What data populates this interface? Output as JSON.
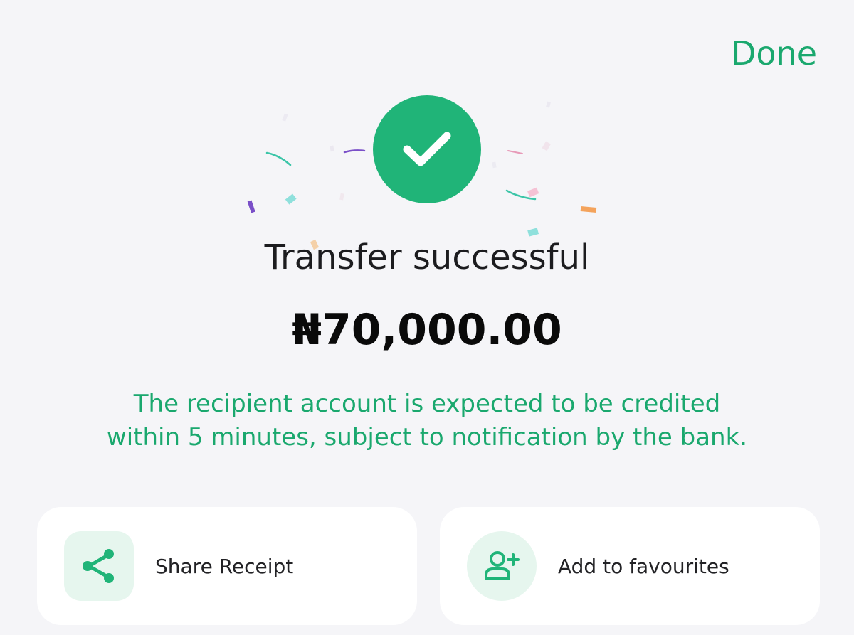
{
  "header": {
    "done_label": "Done"
  },
  "status": {
    "title": "Transfer successful",
    "amount": "₦70,000.00",
    "notice": "The recipient account is expected to be credited within 5 minutes, subject to notification by the bank."
  },
  "actions": [
    {
      "label": "Share Receipt",
      "icon": "share-icon"
    },
    {
      "label": "Add to favourites",
      "icon": "add-user-icon"
    }
  ],
  "colors": {
    "accent": "#20b478",
    "accent_text": "#1aa86e",
    "icon_bg": "#e6f6ee",
    "background": "#f5f5f8",
    "card_bg": "#ffffff"
  }
}
